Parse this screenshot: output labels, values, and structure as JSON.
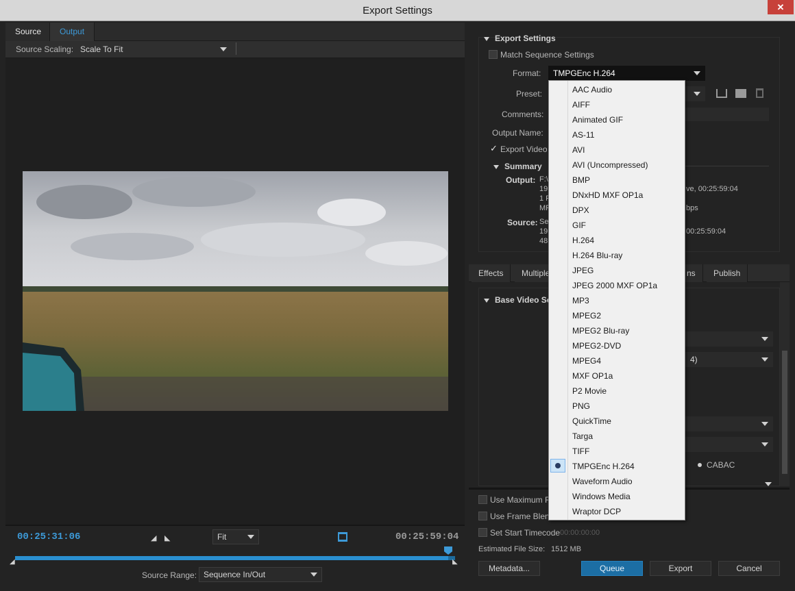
{
  "window": {
    "title": "Export Settings",
    "close": "✕"
  },
  "left": {
    "tabs": [
      "Source",
      "Output"
    ],
    "source_scaling_label": "Source Scaling:",
    "source_scaling_value": "Scale To Fit",
    "timecode_in": "00:25:31:06",
    "timecode_out": "00:25:59:04",
    "zoom": "Fit",
    "source_range_label": "Source Range:",
    "source_range_value": "Sequence In/Out",
    "playhead_progress": 0.985
  },
  "export": {
    "section_title": "Export Settings",
    "match_sequence": "Match Sequence Settings",
    "format_label": "Format:",
    "format_value": "TMPGEnc H.264",
    "preset_label": "Preset:",
    "comments_label": "Comments:",
    "output_name_label": "Output Name:",
    "export_video": "Export Video",
    "summary_title": "Summary",
    "output_label": "Output:",
    "output_lines": [
      "F:\\",
      "19",
      "1 F",
      "MP"
    ],
    "output_tail": [
      "ve, 00:25:59:04",
      "bps"
    ],
    "source_label": "Source:",
    "source_lines": [
      "Se",
      "19",
      "48"
    ],
    "source_tail": "00:25:59:04"
  },
  "settings_tabs": [
    "Effects",
    "Multiple",
    "ns",
    "Publish"
  ],
  "video": {
    "section_title": "Base Video Se",
    "partial_value": "4)",
    "cabac": "CABAC"
  },
  "bottom": {
    "use_max_render": "Use Maximum Re",
    "use_frame_blend": "Use Frame Blend",
    "set_start_tc": "Set Start Timecode",
    "start_tc_value": "00:00:00:00",
    "est_file_size_label": "Estimated File Size:",
    "est_file_size_value": "1512 MB",
    "metadata_button": "Metadata...",
    "queue_button": "Queue",
    "export_button": "Export",
    "cancel_button": "Cancel"
  },
  "format_options": [
    "AAC Audio",
    "AIFF",
    "Animated GIF",
    "AS-11",
    "AVI",
    "AVI (Uncompressed)",
    "BMP",
    "DNxHD MXF OP1a",
    "DPX",
    "GIF",
    "H.264",
    "H.264 Blu-ray",
    "JPEG",
    "JPEG 2000 MXF OP1a",
    "MP3",
    "MPEG2",
    "MPEG2 Blu-ray",
    "MPEG2-DVD",
    "MPEG4",
    "MXF OP1a",
    "P2 Movie",
    "PNG",
    "QuickTime",
    "Targa",
    "TIFF",
    "TMPGEnc H.264",
    "Waveform Audio",
    "Windows Media",
    "Wraptor DCP"
  ],
  "selected_format_index": 25,
  "colors": {
    "accent": "#3d9ad8",
    "timecode": "#3d9ad8",
    "queue": "#1c6ea4"
  }
}
